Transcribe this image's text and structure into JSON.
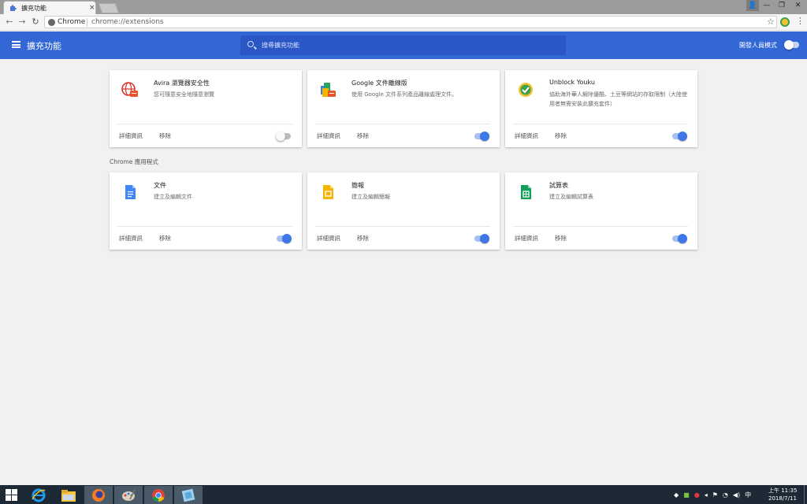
{
  "tab": {
    "title": "擴充功能",
    "close": "×"
  },
  "window_controls": {
    "user": "👤",
    "min": "—",
    "max": "❐",
    "close": "✕"
  },
  "nav": {
    "back": "←",
    "forward": "→",
    "reload": "↻"
  },
  "omnibox": {
    "chip": "Chrome",
    "url": "chrome://extensions",
    "star": "☆",
    "menu": "⋮"
  },
  "header": {
    "title": "擴充功能",
    "search_placeholder": "搜尋擴充功能",
    "devmode_label": "開發人員模式",
    "devmode_on": false
  },
  "colors": {
    "header": "#3367d6",
    "toggle_on": "#3e77e8",
    "background": "#f1f1f1"
  },
  "extensions": [
    {
      "name": "Avira 瀏覽器安全性",
      "desc": "您可隨意安全地隨意瀏覽",
      "details": "詳細資訊",
      "remove": "移除",
      "enabled": false,
      "icon": "avira-globe-icon"
    },
    {
      "name": "Google 文件離線版",
      "desc": "使用 Google 文件系列產品離線處理文件。",
      "details": "詳細資訊",
      "remove": "移除",
      "enabled": true,
      "icon": "google-docs-offline-icon"
    },
    {
      "name": "Unblock Youku",
      "desc": "協助海外華人解除優酷、土豆等網站的存取限制（大陸使用者無需安裝此擴充套件）",
      "details": "詳細資訊",
      "remove": "移除",
      "enabled": true,
      "icon": "unblock-youku-icon"
    }
  ],
  "apps_section_title": "Chrome 應用程式",
  "apps": [
    {
      "name": "文件",
      "desc": "建立及編輯文件",
      "details": "詳細資訊",
      "remove": "移除",
      "enabled": true,
      "icon": "docs-icon"
    },
    {
      "name": "簡報",
      "desc": "建立及編輯簡報",
      "details": "詳細資訊",
      "remove": "移除",
      "enabled": true,
      "icon": "slides-icon"
    },
    {
      "name": "試算表",
      "desc": "建立及編輯試算表",
      "details": "詳細資訊",
      "remove": "移除",
      "enabled": true,
      "icon": "sheets-icon"
    }
  ],
  "taskbar": {
    "apps": [
      "start-icon",
      "ie-icon",
      "file-explorer-icon",
      "firefox-icon",
      "paint-icon",
      "chrome-icon",
      "app-icon"
    ],
    "tray_lang": "中",
    "clock_time": "上午 11:35",
    "clock_date": "2018/7/11"
  }
}
